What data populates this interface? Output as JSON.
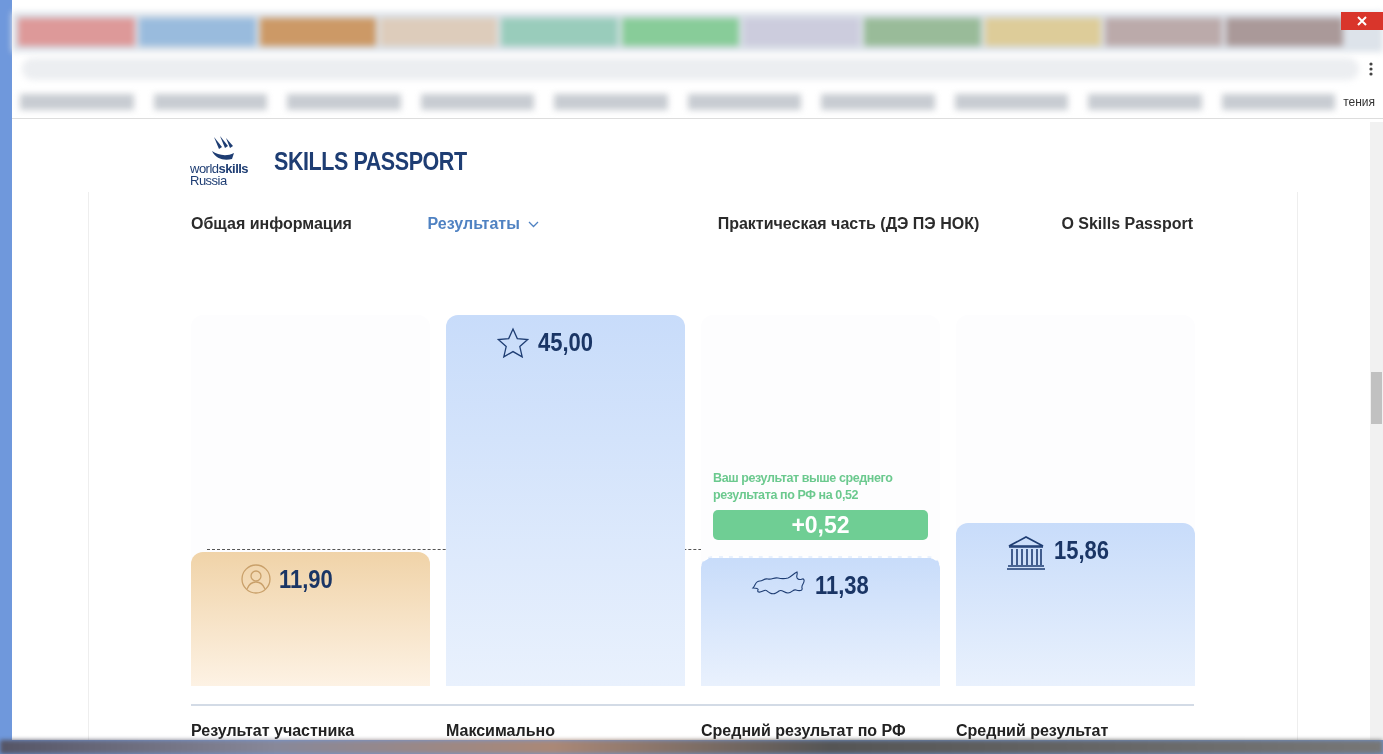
{
  "browser": {
    "bookmarks_tail": "тения"
  },
  "site": {
    "brand_line_1": "world",
    "brand_line_1_bold": "skills",
    "brand_line_2": "Russia",
    "title": "SKILLS PASSPORT"
  },
  "nav": [
    {
      "label": "Общая информация",
      "selected": false,
      "dropdown": false
    },
    {
      "label": "Результаты",
      "selected": true,
      "dropdown": true
    },
    {
      "label": "Практическая часть (ДЭ ПЭ НОК)",
      "selected": false,
      "dropdown": false
    },
    {
      "label": "О Skills Passport",
      "selected": false,
      "dropdown": false
    }
  ],
  "results": [
    {
      "kind": "participant",
      "value": "11,90",
      "level": 0.36,
      "label": "Результат участника"
    },
    {
      "kind": "maximum",
      "value": "45,00",
      "level": 1.0,
      "label": "Максимально"
    },
    {
      "kind": "country",
      "value": "11,38",
      "level": 0.35,
      "label": "Средний результат по РФ",
      "note": "Ваш результат выше среднего результата по РФ на 0,52",
      "difference": "+0,52"
    },
    {
      "kind": "region",
      "value": "15,86",
      "level": 0.44,
      "label": "Средний результат"
    }
  ]
}
